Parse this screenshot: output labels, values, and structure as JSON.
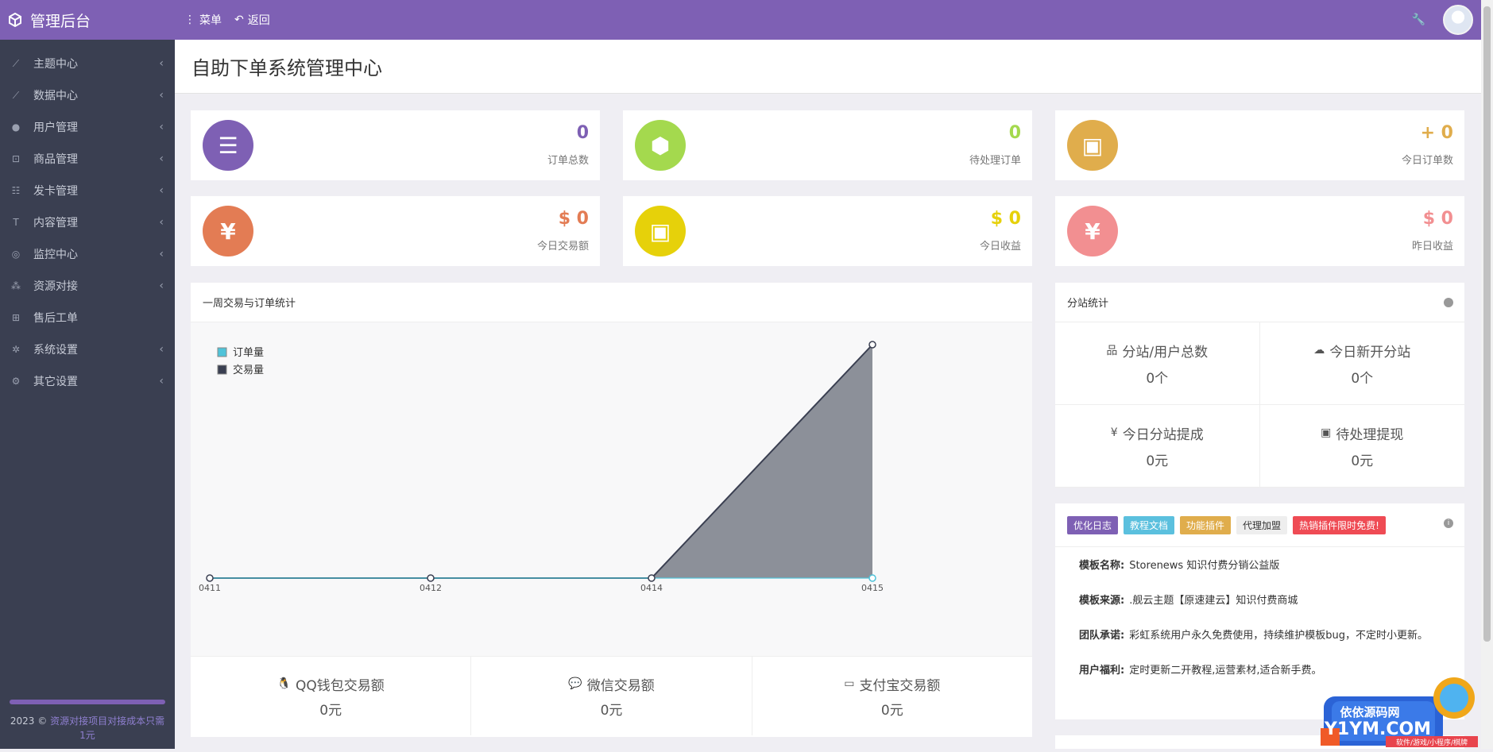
{
  "brand": {
    "title": "管理后台"
  },
  "topnav": {
    "menu": "菜单",
    "back": "返回"
  },
  "sidebar": {
    "items": [
      {
        "label": "主题中心",
        "icon": "chart-line-icon",
        "glyph": "⟋"
      },
      {
        "label": "数据中心",
        "icon": "chart-line-icon",
        "glyph": "⟋"
      },
      {
        "label": "用户管理",
        "icon": "user-icon",
        "glyph": "●"
      },
      {
        "label": "商品管理",
        "icon": "cart-icon",
        "glyph": "⊡"
      },
      {
        "label": "发卡管理",
        "icon": "grid-icon",
        "glyph": "☷"
      },
      {
        "label": "内容管理",
        "icon": "text-icon",
        "glyph": "T"
      },
      {
        "label": "监控中心",
        "icon": "target-icon",
        "glyph": "◎"
      },
      {
        "label": "资源对接",
        "icon": "cubes-icon",
        "glyph": "⁂"
      },
      {
        "label": "售后工单",
        "icon": "plus-square-icon",
        "glyph": "⊞"
      },
      {
        "label": "系统设置",
        "icon": "gear-icon",
        "glyph": "✲"
      },
      {
        "label": "其它设置",
        "icon": "gears-icon",
        "glyph": "⚙"
      }
    ],
    "footer_year": "2023 ©",
    "footer_link": "资源对接项目对接成本只需1元"
  },
  "page": {
    "title": "自助下单系统管理中心"
  },
  "stats": [
    {
      "value": "0",
      "label": "订单总数",
      "color": "#7e60b4",
      "valcolor": "#7e60b4",
      "icon": "list-ol-icon",
      "glyph": "☰"
    },
    {
      "value": "0",
      "label": "待处理订单",
      "color": "#a4d94e",
      "valcolor": "#a4d94e",
      "icon": "cube-icon",
      "glyph": "⬢"
    },
    {
      "value": "+ 0",
      "label": "今日订单数",
      "color": "#e0ad4c",
      "valcolor": "#e0ad4c",
      "icon": "briefcase-icon",
      "glyph": "▣"
    },
    {
      "value": "$ 0",
      "label": "今日交易额",
      "color": "#e37c54",
      "valcolor": "#e37c54",
      "icon": "yen-icon",
      "glyph": "¥"
    },
    {
      "value": "$ 0",
      "label": "今日收益",
      "color": "#e6d10a",
      "valcolor": "#e6d10a",
      "icon": "briefcase-icon",
      "glyph": "▣"
    },
    {
      "value": "$ 0",
      "label": "昨日收益",
      "color": "#f28f91",
      "valcolor": "#f28f91",
      "icon": "yen-icon",
      "glyph": "¥"
    }
  ],
  "chart_panel": {
    "title": "一周交易与订单统计"
  },
  "chart_data": {
    "type": "area",
    "categories": [
      "0411",
      "0412",
      "0414",
      "0415"
    ],
    "series": [
      {
        "name": "订单量",
        "values": [
          0,
          0,
          0,
          0
        ],
        "color": "#4fc3d9"
      },
      {
        "name": "交易量",
        "values": [
          0,
          0,
          0,
          1
        ],
        "color": "#3a3f51"
      }
    ],
    "ylim": [
      0,
      1
    ],
    "legend": "top-left"
  },
  "payments": [
    {
      "label": "QQ钱包交易额",
      "value": "0元",
      "icon": "qq-icon",
      "glyph": "🐧"
    },
    {
      "label": "微信交易额",
      "value": "0元",
      "icon": "wechat-icon",
      "glyph": "💬"
    },
    {
      "label": "支付宝交易额",
      "value": "0元",
      "icon": "credit-card-icon",
      "glyph": "▭"
    }
  ],
  "substation": {
    "title": "分站统计",
    "cells": [
      {
        "label": "分站/用户总数",
        "value": "0个",
        "icon": "sitemap-icon",
        "glyph": "品"
      },
      {
        "label": "今日新开分站",
        "value": "0个",
        "icon": "cloud-icon",
        "glyph": "☁"
      },
      {
        "label": "今日分站提成",
        "value": "0元",
        "icon": "yen-icon",
        "glyph": "¥"
      },
      {
        "label": "待处理提现",
        "value": "0元",
        "icon": "money-icon",
        "glyph": "▣"
      }
    ]
  },
  "info_panel": {
    "tags": [
      {
        "label": "优化日志",
        "color": "#7e60b4",
        "text": "#ffffff"
      },
      {
        "label": "教程文档",
        "color": "#5bc0de",
        "text": "#ffffff"
      },
      {
        "label": "功能插件",
        "color": "#e0ad4c",
        "text": "#ffffff"
      },
      {
        "label": "代理加盟",
        "color": "#eeeeee",
        "text": "#333333"
      },
      {
        "label": "热销插件限时免费!",
        "color": "#ef4b54",
        "text": "#ffffff"
      }
    ],
    "rows": [
      {
        "key": "模板名称:",
        "value": "Storenews 知识付费分销公益版"
      },
      {
        "key": "模板来源:",
        "value": ".舰云主题【原速建云】知识付费商城"
      },
      {
        "key": "团队承诺:",
        "value": "彩虹系统用户永久免费使用，持续维护模板bug，不定时小更新。"
      },
      {
        "key": "用户福利:",
        "value": "定时更新二开教程,运营素材,适合新手费。"
      }
    ]
  },
  "watermark": {
    "title": "依依源码网",
    "domain": "Y1YM.COM",
    "sub": "软件/游戏/小程序/棋牌"
  }
}
